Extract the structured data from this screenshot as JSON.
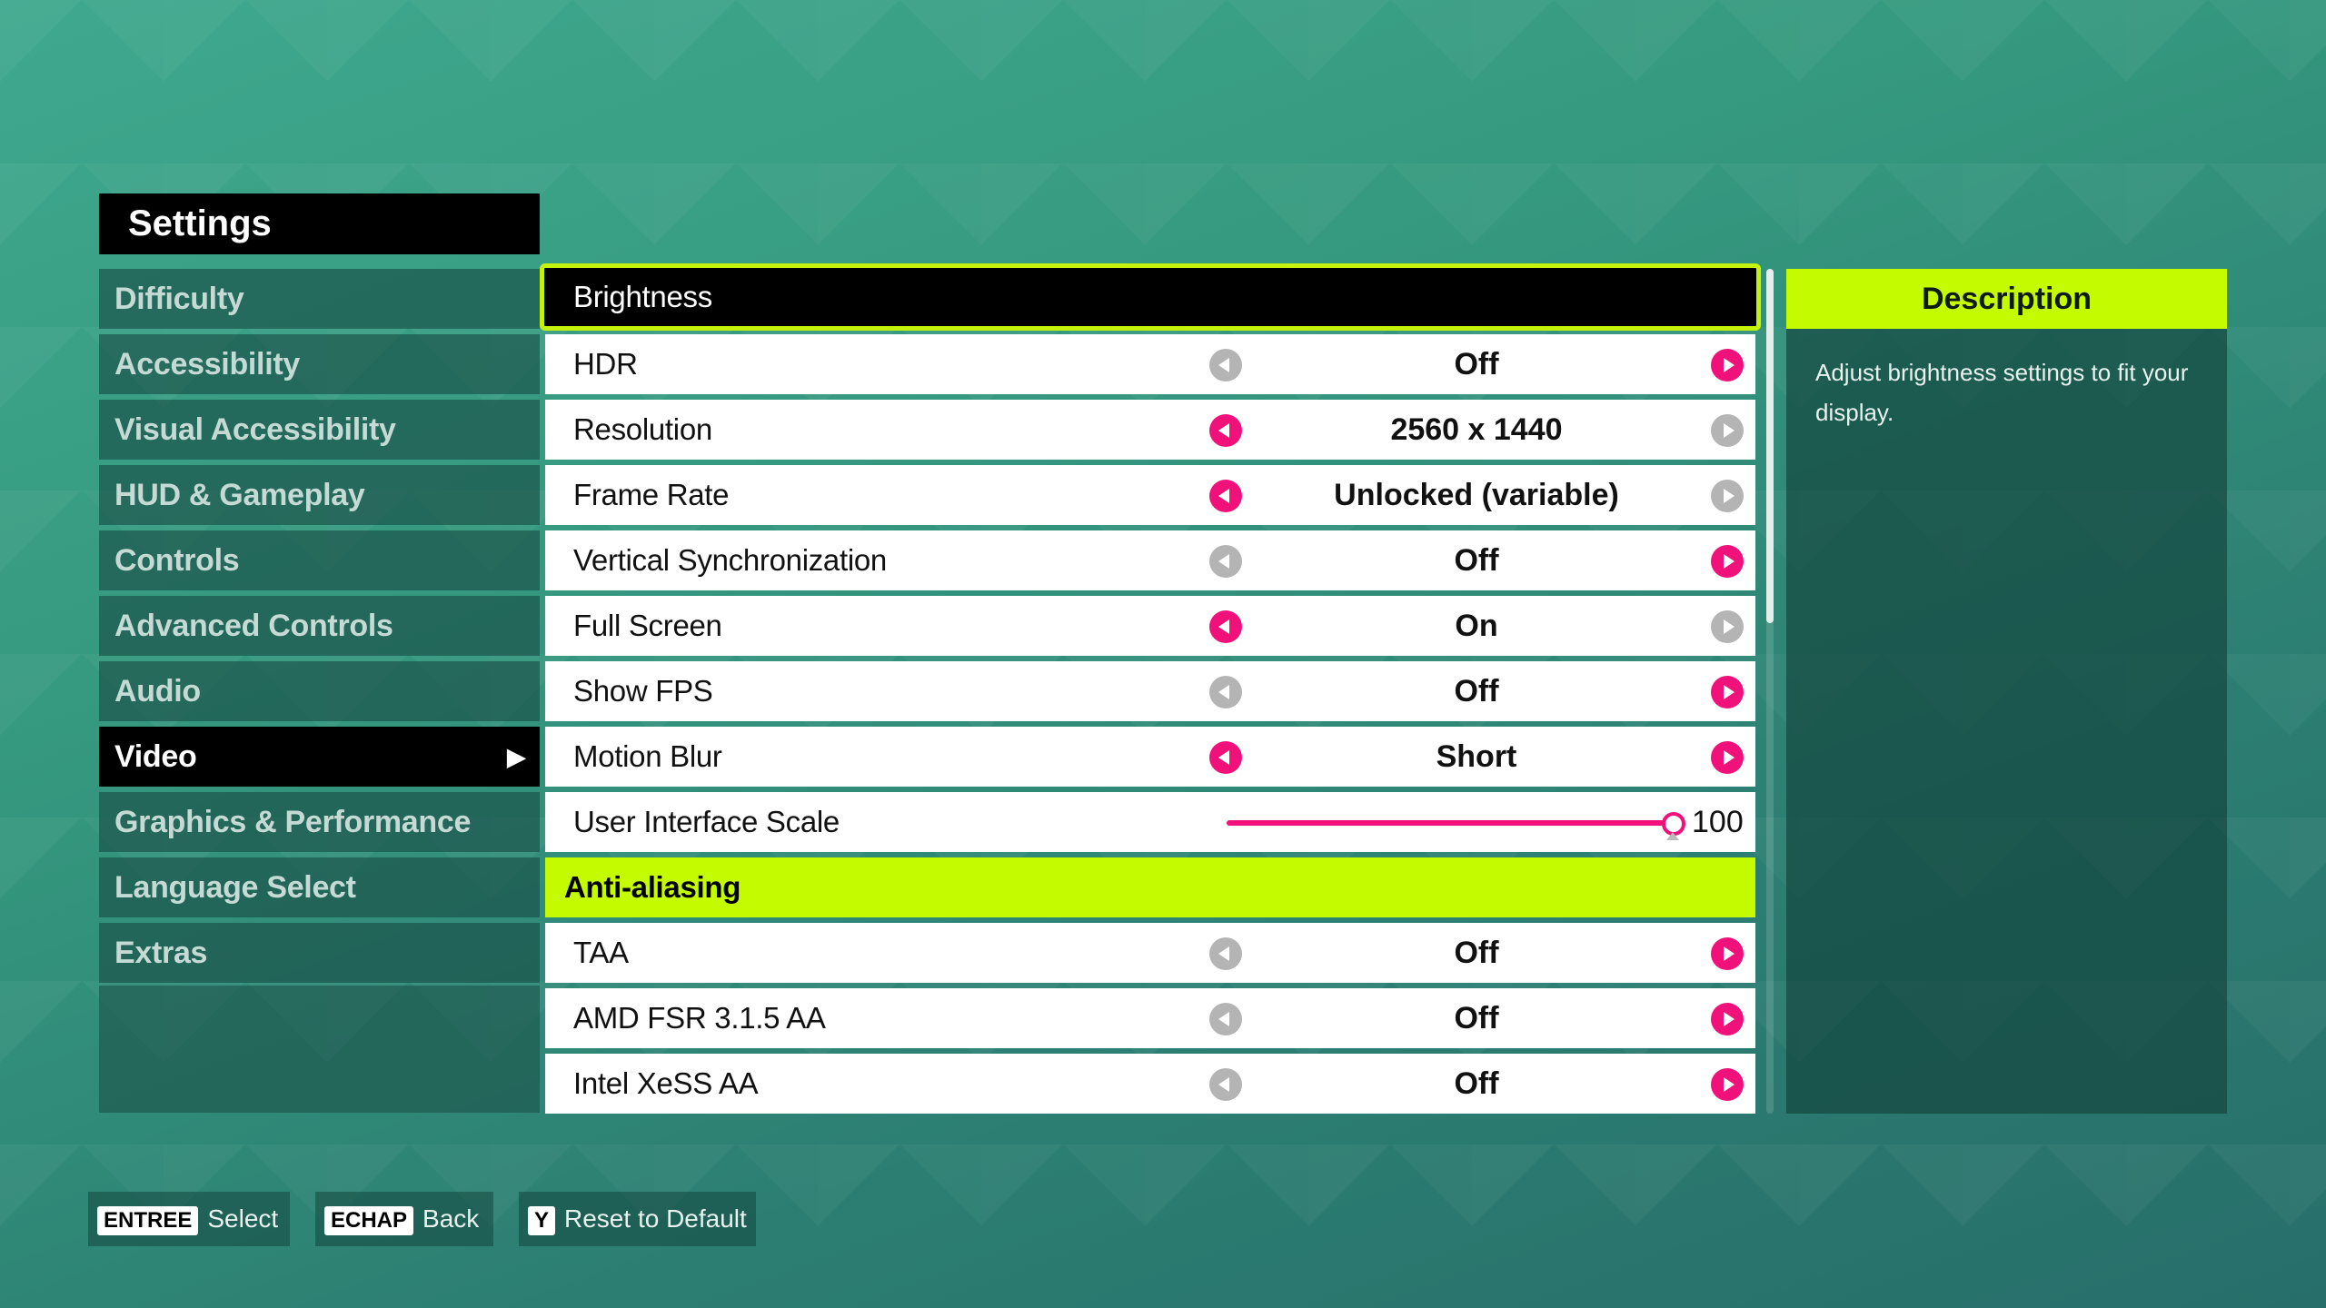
{
  "header": {
    "title": "Settings"
  },
  "sidebar": {
    "items": [
      {
        "label": "Difficulty"
      },
      {
        "label": "Accessibility"
      },
      {
        "label": "Visual Accessibility"
      },
      {
        "label": "HUD & Gameplay"
      },
      {
        "label": "Controls"
      },
      {
        "label": "Advanced Controls"
      },
      {
        "label": "Audio"
      },
      {
        "label": "Video",
        "active": true
      },
      {
        "label": "Graphics & Performance"
      },
      {
        "label": "Language Select"
      },
      {
        "label": "Extras"
      }
    ],
    "active_arrow": "▶"
  },
  "settings": {
    "brightness": {
      "label": "Brightness"
    },
    "hdr": {
      "label": "HDR",
      "value": "Off"
    },
    "resolution": {
      "label": "Resolution",
      "value": "2560 x 1440"
    },
    "frame_rate": {
      "label": "Frame Rate",
      "value": "Unlocked (variable)"
    },
    "vsync": {
      "label": "Vertical Synchronization",
      "value": "Off"
    },
    "full_screen": {
      "label": "Full Screen",
      "value": "On"
    },
    "show_fps": {
      "label": "Show FPS",
      "value": "Off"
    },
    "motion_blur": {
      "label": "Motion Blur",
      "value": "Short"
    },
    "ui_scale": {
      "label": "User Interface Scale",
      "value": "100"
    },
    "aa_section": {
      "label": "Anti-aliasing"
    },
    "taa": {
      "label": "TAA",
      "value": "Off"
    },
    "fsr": {
      "label": "AMD FSR 3.1.5 AA",
      "value": "Off"
    },
    "xess": {
      "label": "Intel XeSS AA",
      "value": "Off"
    }
  },
  "description": {
    "title": "Description",
    "text": "Adjust brightness settings to fit your display."
  },
  "footer": {
    "select": {
      "key": "ENTREE",
      "label": "Select"
    },
    "back": {
      "key": "ECHAP",
      "label": "Back"
    },
    "reset": {
      "key": "Y",
      "label": "Reset to Default"
    }
  },
  "colors": {
    "accent_pink": "#f0127a",
    "accent_lime": "#c5fb00",
    "disabled_gray": "#b4b4b4"
  }
}
